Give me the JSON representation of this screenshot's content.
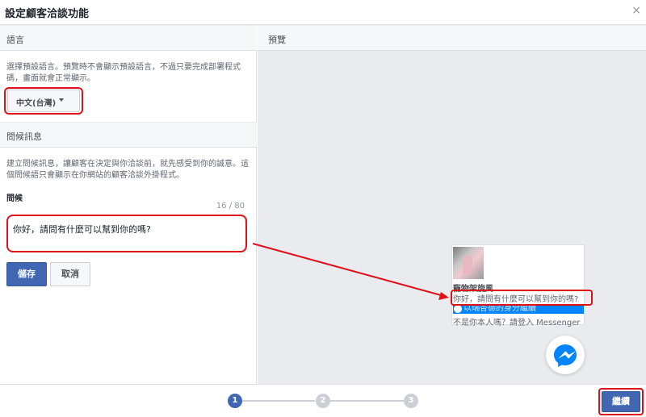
{
  "dialog": {
    "title": "設定顧客洽談功能",
    "close_glyph": "×"
  },
  "language_section": {
    "heading": "語言",
    "description": "選擇預設語言。預覽時不會顯示預設語言，不過只要完成部署程式碼，畫面就會正常顯示。",
    "selected_language": "中文(台灣)"
  },
  "greeting_section": {
    "heading": "問候訊息",
    "description": "建立問候訊息，讓顧客在決定與你洽談前，就先感受到你的誠意。這個問候語只會顯示在你網站的顧客洽談外掛程式。",
    "field_label": "問候",
    "counter": "16 / 80",
    "value": "你好，請問有什麼可以幫到你的嗎?",
    "save_label": "儲存",
    "cancel_label": "取消"
  },
  "preview": {
    "heading": "預覽",
    "page_name": "寵物架旋風",
    "greeting": "你好，請問有什麼可以幫到你的嗎?",
    "continue_label": "以瑞杏德的身分繼續",
    "not_you_label": "不是你本人嗎？請登入 Messenger",
    "messenger_icon": "messenger-icon"
  },
  "footer": {
    "steps": [
      "1",
      "2",
      "3"
    ],
    "active_step": 1,
    "next_label": "繼續"
  },
  "colors": {
    "accent": "#4267b2",
    "highlight": "#e0101a",
    "messenger": "#0084ff"
  }
}
